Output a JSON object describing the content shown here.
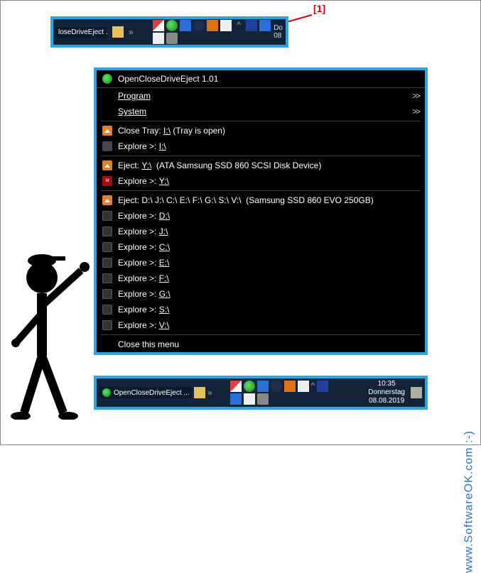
{
  "annotation": {
    "label": "[1]"
  },
  "taskbar_top": {
    "button": "loseDriveEject ...",
    "clock_short": "Do\n08"
  },
  "menu": {
    "title": "OpenCloseDriveEject 1.01",
    "program": "Program",
    "system": "System",
    "chev": ">>",
    "close_label": "Close Tray:",
    "close_drive": "I:\\",
    "close_suffix": "(Tray is open)",
    "explore_prefix": "Explore >:",
    "explore_i": "I:\\",
    "eject_label1": "Eject:",
    "eject_drive1": "Y:\\",
    "eject_device1": "(ATA Samsung SSD 860 SCSI Disk Device)",
    "explore_y": "Y:\\",
    "eject_label2": "Eject:",
    "eject_drives2": "D:\\ J:\\ C:\\ E:\\ F:\\ G:\\ S:\\ V:\\",
    "eject_device2": "(Samsung SSD 860 EVO 250GB)",
    "explore_d": "D:\\",
    "explore_j": "J:\\",
    "explore_c": "C:\\",
    "explore_e": "E:\\",
    "explore_f": "F:\\",
    "explore_g": "G:\\",
    "explore_s": "S:\\",
    "explore_v": "V:\\",
    "close_menu": "Close this menu"
  },
  "taskbar_bottom": {
    "app": "OpenCloseDriveEject ...",
    "time": "10:35",
    "day": "Donnerstag",
    "date": "08.08.2019"
  },
  "watermark": "www.SoftwareOK.com :-)"
}
